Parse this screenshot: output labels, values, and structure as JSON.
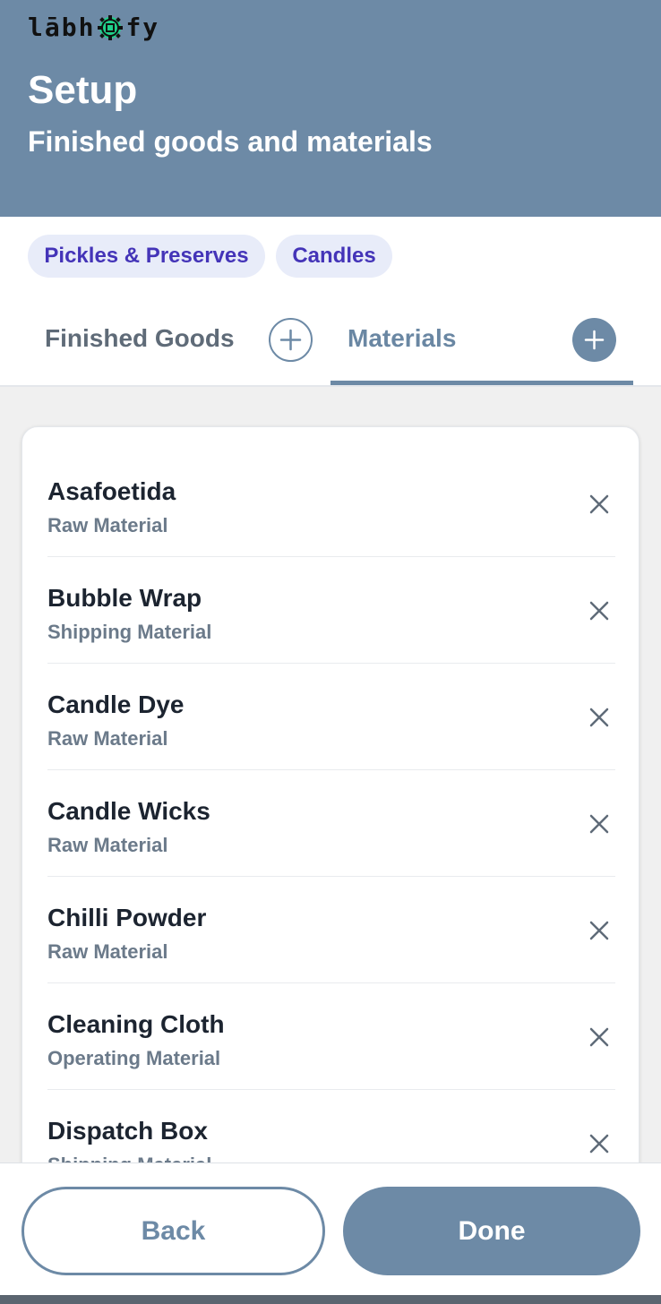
{
  "brand": {
    "logo_prefix": "lābh",
    "logo_suffix": "fy",
    "logo_icon": "gear-chip-icon"
  },
  "header": {
    "title": "Setup",
    "subtitle": "Finished goods and materials"
  },
  "categories": [
    {
      "label": "Pickles & Preserves"
    },
    {
      "label": "Candles"
    }
  ],
  "tabs": {
    "finished_goods": "Finished Goods",
    "materials": "Materials",
    "active": "Materials"
  },
  "materials": [
    {
      "name": "Asafoetida",
      "type": "Raw Material"
    },
    {
      "name": "Bubble Wrap",
      "type": "Shipping Material"
    },
    {
      "name": "Candle Dye",
      "type": "Raw Material"
    },
    {
      "name": "Candle Wicks",
      "type": "Raw Material"
    },
    {
      "name": "Chilli Powder",
      "type": "Raw Material"
    },
    {
      "name": "Cleaning Cloth",
      "type": "Operating Material"
    },
    {
      "name": "Dispatch Box",
      "type": "Shipping Material"
    }
  ],
  "actions": {
    "back": "Back",
    "done": "Done"
  },
  "colors": {
    "primary": "#6d8aa6",
    "chip_bg": "#e8ecf9",
    "chip_text": "#4434b8",
    "logo_accent": "#1fd18a"
  }
}
